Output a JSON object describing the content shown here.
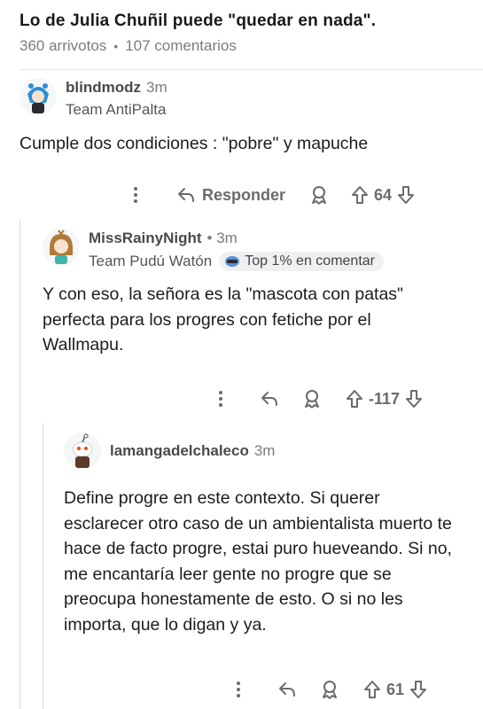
{
  "post": {
    "title": "Lo de Julia Chuñil puede \"quedar en nada\".",
    "upvotes": "360 arrivotos",
    "comments": "107 comentarios"
  },
  "comments": [
    {
      "username": "blindmodz",
      "age": "3m",
      "flair": "Team AntiPalta",
      "body": "Cumple dos condiciones : \"pobre\" y mapuche",
      "reply_label": "Responder",
      "score": "64"
    },
    {
      "username": "MissRainyNight",
      "age": "• 3m",
      "flair": "Team Pudú Watón",
      "badge": "Top 1% en comentar",
      "body": "Y con eso, la señora es la \"mascota con patas\" perfecta para los progres con fetiche por el Wallmapu.",
      "score": "-117"
    },
    {
      "username": "lamangadelchaleco",
      "age": "3m",
      "body": "Define progre en este contexto. Si querer esclarecer otro caso de un ambientalista muerto te hace de facto progre, estai puro hueveando. Si no, me encantaría leer gente no progre que se preocupa honestamente de esto. O si no les importa, que lo digan y ya.",
      "score": "61"
    }
  ],
  "icons": [
    "more-icon",
    "reply-icon",
    "award-icon",
    "upvote-icon",
    "downvote-icon",
    "badge-icon"
  ]
}
